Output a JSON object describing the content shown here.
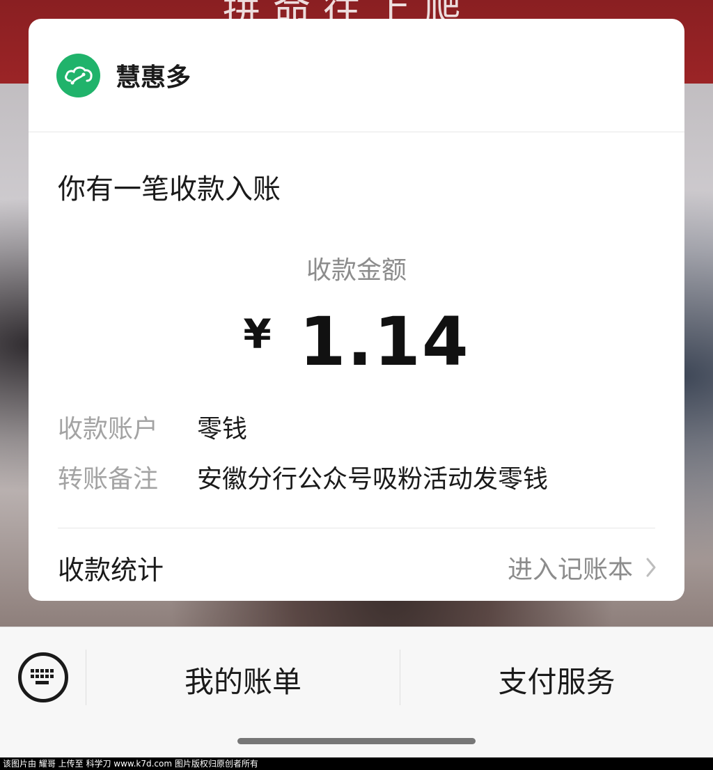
{
  "background": {
    "banner_text": "拼命往上爬"
  },
  "merchant": {
    "name": "慧惠多",
    "logo_icon": "cloud-link-icon",
    "logo_color": "#20b36b"
  },
  "notice": {
    "title": "你有一笔收款入账"
  },
  "amount": {
    "label": "收款金额",
    "currency": "¥",
    "value": "1.14"
  },
  "details": [
    {
      "key": "收款账户",
      "value": "零钱"
    },
    {
      "key": "转账备注",
      "value": "安徽分行公众号吸粉活动发零钱"
    }
  ],
  "stats": {
    "label": "收款统计",
    "link": "进入记账本"
  },
  "bottom_menu": {
    "keyboard_icon": "keyboard-icon",
    "items": [
      {
        "label": "我的账单"
      },
      {
        "label": "支付服务"
      }
    ]
  },
  "watermark": {
    "text": "该图片由 耀哥 上传至 科学刀 www.k7d.com 图片版权归原创者所有"
  }
}
